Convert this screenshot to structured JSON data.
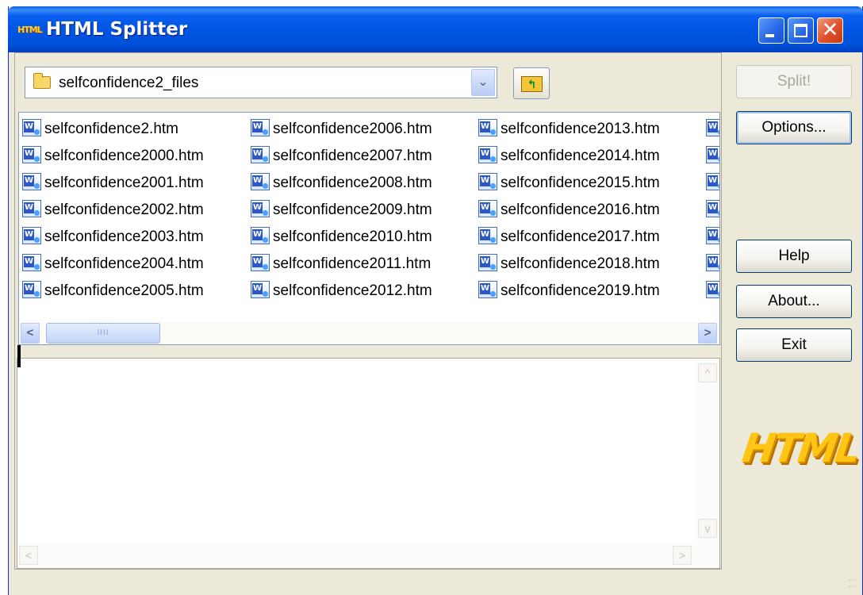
{
  "window": {
    "title": "HTML Splitter",
    "app_icon_text": "HTML",
    "controls": {
      "minimize": "_",
      "maximize": "□",
      "close": "✕"
    }
  },
  "folder": {
    "current": "selfconfidence2_files",
    "dropdown_icon": "chevron-down-icon",
    "up_button_icon": "up-folder-icon"
  },
  "files": {
    "columns": [
      [
        "selfconfidence2.htm",
        "selfconfidence2000.htm",
        "selfconfidence2001.htm",
        "selfconfidence2002.htm",
        "selfconfidence2003.htm",
        "selfconfidence2004.htm",
        "selfconfidence2005.htm"
      ],
      [
        "selfconfidence2006.htm",
        "selfconfidence2007.htm",
        "selfconfidence2008.htm",
        "selfconfidence2009.htm",
        "selfconfidence2010.htm",
        "selfconfidence2011.htm",
        "selfconfidence2012.htm"
      ],
      [
        "selfconfidence2013.htm",
        "selfconfidence2014.htm",
        "selfconfidence2015.htm",
        "selfconfidence2016.htm",
        "selfconfidence2017.htm",
        "selfconfidence2018.htm",
        "selfconfidence2019.htm"
      ]
    ],
    "file_icon": "word-document-icon",
    "scrollbar": {
      "left": "<",
      "right": ">",
      "thumb_grip": "IIII"
    }
  },
  "output": {
    "text": "",
    "scroll_up": "^",
    "scroll_down": "v",
    "scroll_left": "<",
    "scroll_right": ">"
  },
  "buttons": {
    "split": "Split!",
    "options": "Options...",
    "help": "Help",
    "about": "About...",
    "exit": "Exit"
  },
  "logo": {
    "text": "HTML"
  },
  "colors": {
    "titlebar": "#0054e3",
    "window_bg": "#ece9d8",
    "logo": "#ffc514",
    "close_button": "#e0502a"
  }
}
